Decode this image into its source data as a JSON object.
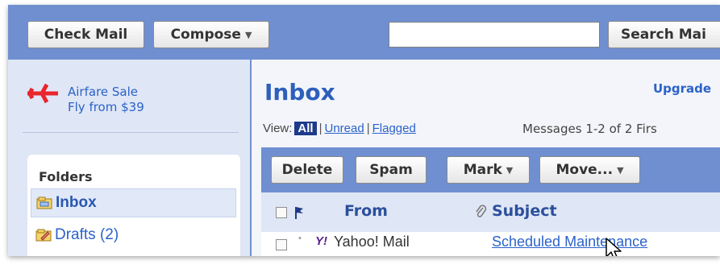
{
  "toolbar": {
    "check_mail": "Check Mail",
    "compose": "Compose",
    "search_button": "Search Mai",
    "search_value": ""
  },
  "ad": {
    "line1": "Airfare Sale",
    "line2": "Fly from $39"
  },
  "folders": {
    "title": "Folders",
    "items": [
      {
        "label": "Inbox",
        "selected": true
      },
      {
        "label": "Drafts (2)",
        "selected": false
      }
    ]
  },
  "main": {
    "title": "Inbox",
    "upgrade": "Upgrade",
    "view_label": "View:",
    "filters": {
      "all": "All",
      "unread": "Unread",
      "flagged": "Flagged"
    },
    "message_count": "Messages 1-2 of 2  Firs"
  },
  "actions": {
    "delete": "Delete",
    "spam": "Spam",
    "mark": "Mark",
    "move": "Move..."
  },
  "columns": {
    "from": "From",
    "subject": "Subject"
  },
  "messages": [
    {
      "from": "Yahoo! Mail",
      "subject": "Scheduled Maintenance",
      "sender_logo": "Y!"
    }
  ],
  "colors": {
    "accent": "#6f8fd1",
    "link": "#2b62c9",
    "ad_plane": "#e8262b",
    "yahoo_purple": "#5b1f8f"
  }
}
